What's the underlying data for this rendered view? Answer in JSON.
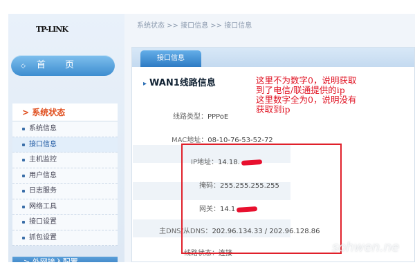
{
  "sidebar": {
    "logo": "TP-LINK",
    "home_label": "首 页",
    "menu_head": "> 系统状态",
    "items": [
      {
        "label": "系统信息"
      },
      {
        "label": "接口信息"
      },
      {
        "label": "主机监控"
      },
      {
        "label": "用户信息"
      },
      {
        "label": "日志服务"
      },
      {
        "label": "网络工具"
      },
      {
        "label": "接口设置"
      },
      {
        "label": "抓包设置"
      }
    ],
    "next_section": "> 外网接入配置"
  },
  "breadcrumb": "系统状态 >> 接口信息 >> 接口信息",
  "tab_label": "接口信息",
  "section_title": "WAN1线路信息",
  "fields": {
    "line_type": {
      "label": "线路类型：",
      "value": "PPPoE"
    },
    "mac": {
      "label": "MAC地址：",
      "value": "08-10-76-53-52-72"
    },
    "ip": {
      "label": "IP地址：",
      "value": "14.18."
    },
    "mask": {
      "label": "掩码：",
      "value": "255.255.255.255"
    },
    "gateway": {
      "label": "网关：",
      "value": "14.1"
    },
    "dns": {
      "label": "主DNS/从DNS：",
      "value": "202.96.134.33 / 202.96.128.86"
    },
    "status": {
      "label": "线路状态：",
      "value": "连接"
    }
  },
  "annotation": {
    "line1": "这里不为数字0，说明获取",
    "line2": "到了电信/联通提供的ip",
    "line3": "这里数字全为0，说明没有",
    "line4": "获取到ip"
  },
  "watermark": "sohwen.ne",
  "colors": {
    "accent": "#2d7bc4",
    "annotation": "#e01020"
  }
}
